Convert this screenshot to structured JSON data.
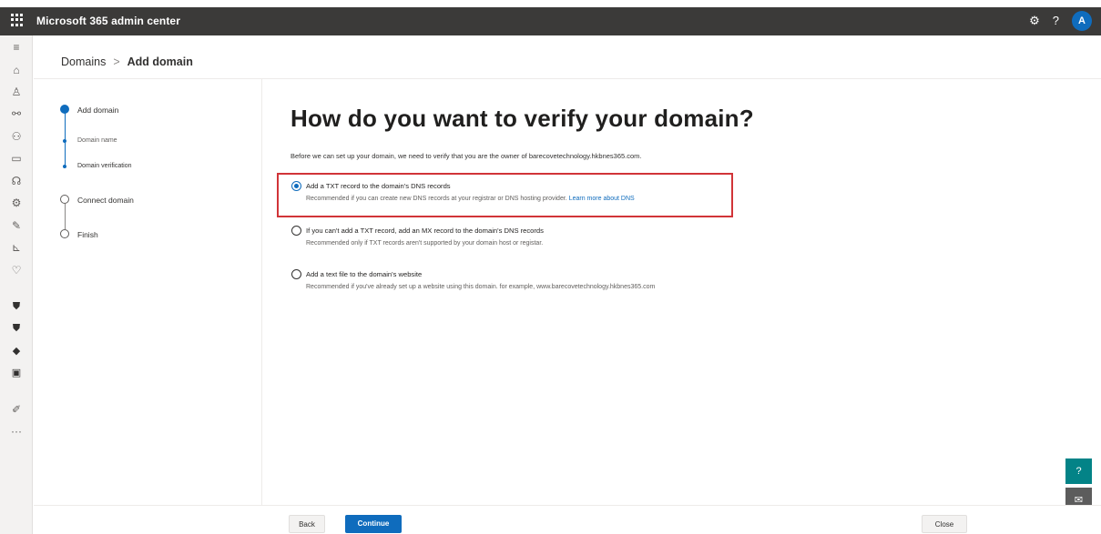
{
  "app": {
    "title": "Microsoft 365 admin center",
    "avatar_initial": "A",
    "settings_glyph": "⚙",
    "help_glyph": "?"
  },
  "rail": {
    "icons": [
      {
        "name": "menu-icon",
        "glyph": "≡"
      },
      {
        "name": "home-icon",
        "glyph": "⌂"
      },
      {
        "name": "user-icon",
        "glyph": "♙"
      },
      {
        "name": "contacts-icon",
        "glyph": "⚯"
      },
      {
        "name": "groups-icon",
        "glyph": "⚇"
      },
      {
        "name": "billing-icon",
        "glyph": "▭"
      },
      {
        "name": "support-icon",
        "glyph": "☊"
      },
      {
        "name": "settings-icon",
        "glyph": "⚙"
      },
      {
        "name": "setup-icon",
        "glyph": "✎"
      },
      {
        "name": "reports-icon",
        "glyph": "⊾"
      },
      {
        "name": "health-icon",
        "glyph": "♡"
      },
      {
        "name": "security-icon",
        "glyph": "⛊"
      },
      {
        "name": "compliance-icon",
        "glyph": "⛊"
      },
      {
        "name": "endpoint-icon",
        "glyph": "◆"
      },
      {
        "name": "exchange-icon",
        "glyph": "▣"
      },
      {
        "name": "customize-icon",
        "glyph": "✐"
      },
      {
        "name": "more-icon",
        "glyph": "···"
      }
    ]
  },
  "breadcrumb": {
    "parent": "Domains",
    "separator": ">",
    "current": "Add domain"
  },
  "stepper": {
    "steps": [
      {
        "label": "Add domain",
        "state": "current"
      },
      {
        "label": "Domain name",
        "state": "sub"
      },
      {
        "label": "Domain verification",
        "state": "sub-current"
      },
      {
        "label": "Connect domain",
        "state": "pending"
      },
      {
        "label": "Finish",
        "state": "pending"
      }
    ]
  },
  "main": {
    "title": "How do you want to verify your domain?",
    "intro": "Before we can set up your domain, we need to verify that you are the owner of barecovetechnology.hkbnes365.com.",
    "options": [
      {
        "title": "Add a TXT record to the domain's DNS records",
        "desc": "Recommended if you can create new DNS records at your registrar or DNS hosting provider.",
        "link": "Learn more about DNS",
        "checked": true
      },
      {
        "title": "If you can't add a TXT record, add an MX record to the domain's DNS records",
        "desc": "Recommended only if TXT records aren't supported by your domain host or registar.",
        "checked": false
      },
      {
        "title": "Add a text file to the domain's website",
        "desc": "Recommended if you've already set up a website using this domain. for example, www.barecovetechnology.hkbnes365.com",
        "checked": false
      }
    ]
  },
  "footer": {
    "back_label": "Back",
    "continue_label": "Continue",
    "close_label": "Close"
  },
  "floating": {
    "help_glyph": "?",
    "feedback_glyph": "✉"
  },
  "colors": {
    "accent": "#0f6cbd",
    "topbar": "#3b3a39",
    "highlight": "#d13438",
    "help_button": "#038387"
  }
}
